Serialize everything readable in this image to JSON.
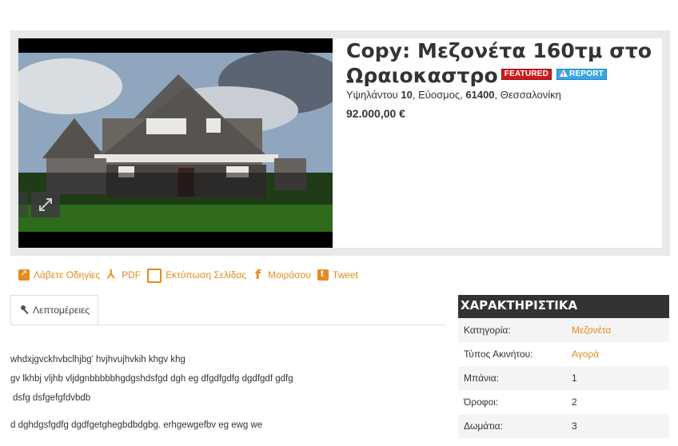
{
  "listing": {
    "title": "Copy: Μεζονέτα 160τμ στο Ωραιοκαστρο",
    "badges": {
      "featured": "FEATURED",
      "report": "REPORT"
    },
    "address": {
      "street": "Υψηλάντου",
      "number": "10",
      "area": "Εύοσμος",
      "zip": "61400",
      "city": "Θεσσαλονίκη"
    },
    "price": "92.000,00 €"
  },
  "actions": [
    {
      "label": "Λάβετε Οδηγίες",
      "icon": "directions-icon"
    },
    {
      "label": "PDF",
      "icon": "pdf-icon"
    },
    {
      "label": "Εκτύπωση Σελίδας",
      "icon": "print-icon"
    },
    {
      "label": "Μοιράσου",
      "icon": "facebook-icon"
    },
    {
      "label": "Tweet",
      "icon": "twitter-icon"
    }
  ],
  "tabs": [
    {
      "label": "Λεπτομέρειες",
      "icon": "key-icon"
    }
  ],
  "description": [
    "whdxjgvckhvbclhjbg' hvjhvujhvkih khgv khg",
    "gv lkhbj vljhb vljdgnbbbbbhgdgshdsfgd dgh eg dfgdfgdfg dgdfgdf gdfg",
    "dsfg dsfgefgfdvbdb",
    "d dghdgsfgdfg dgdfgetghegbdbdgbg. erhgewgefbv eg ewg we"
  ],
  "specs": {
    "title": "ΧΑΡΑΚΤΗΡΙΣΤΙΚΑ",
    "rows": [
      {
        "label": "Κατηγορία:",
        "value": "Μεζονέτα",
        "link": true
      },
      {
        "label": "Τύπος Ακινήτου:",
        "value": "Αγορά",
        "link": true
      },
      {
        "label": "Μπάνια:",
        "value": "1",
        "link": false
      },
      {
        "label": "Όροφοι:",
        "value": "2",
        "link": false
      },
      {
        "label": "Δωμάτια:",
        "value": "3",
        "link": false
      }
    ]
  },
  "colors": {
    "accent": "#e58a1f",
    "featured": "#d0191e",
    "report": "#3aa7e3",
    "header": "#333333"
  }
}
